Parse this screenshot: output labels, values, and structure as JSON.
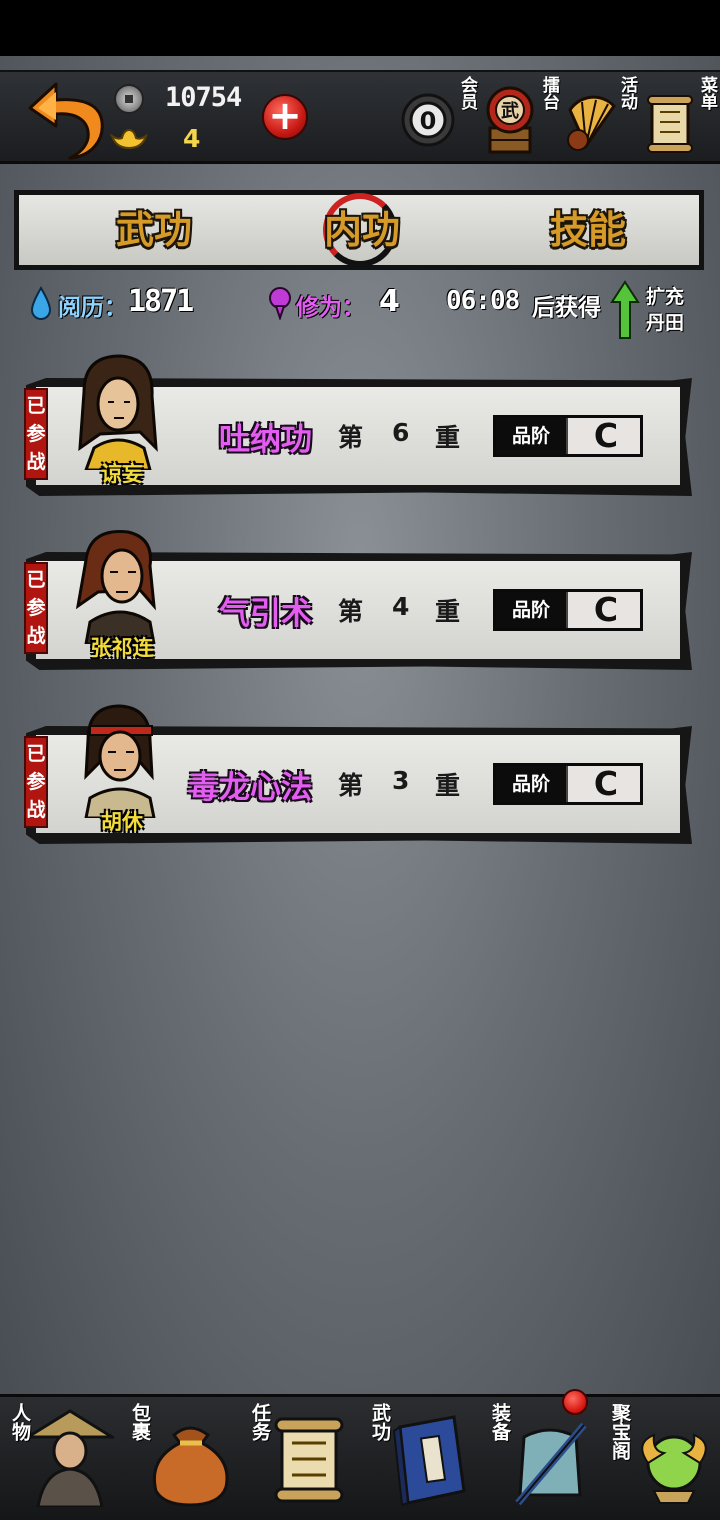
{
  "header": {
    "coins": "10754",
    "gold": "4",
    "add_label": "+",
    "vip_label": "会员",
    "arena_label": "擂台",
    "events_label": "活动",
    "menu_label": "菜单",
    "drum_char": "武"
  },
  "tabs": [
    {
      "label": "武功",
      "active": false
    },
    {
      "label": "内功",
      "active": true
    },
    {
      "label": "技能",
      "active": false
    }
  ],
  "stats": {
    "experience_label": "阅历：",
    "experience_value": "1871",
    "cultivation_label": "修为：",
    "cultivation_value": "4",
    "timer": "06:08",
    "timer_suffix": "后获得",
    "expand_label_1": "扩充",
    "expand_label_2": "丹田"
  },
  "skills": [
    {
      "tag": "已参战",
      "hero": "谅妄",
      "skill": "吐纳功",
      "prefix": "第",
      "level": "6",
      "suffix": "重",
      "grade_label": "品阶",
      "grade": "C"
    },
    {
      "tag": "已参战",
      "hero": "张祁连",
      "skill": "气引术",
      "prefix": "第",
      "level": "4",
      "suffix": "重",
      "grade_label": "品阶",
      "grade": "C"
    },
    {
      "tag": "已参战",
      "hero": "胡休",
      "skill": "毒龙心法",
      "prefix": "第",
      "level": "3",
      "suffix": "重",
      "grade_label": "品阶",
      "grade": "C"
    }
  ],
  "nav": [
    {
      "label": "人物",
      "icon": "character-icon"
    },
    {
      "label": "包裹",
      "icon": "bag-icon"
    },
    {
      "label": "任务",
      "icon": "scroll-icon"
    },
    {
      "label": "武功",
      "icon": "martial-book-icon"
    },
    {
      "label": "装备",
      "icon": "equipment-icon"
    },
    {
      "label": "聚宝阁",
      "icon": "treasure-icon"
    }
  ],
  "colors": {
    "tab_text": "#d59a27",
    "skill_text": "#e35ef0",
    "hero_name": "#f3dc3a",
    "tag_bg": "#b0160f",
    "notify": "#d0120c"
  }
}
